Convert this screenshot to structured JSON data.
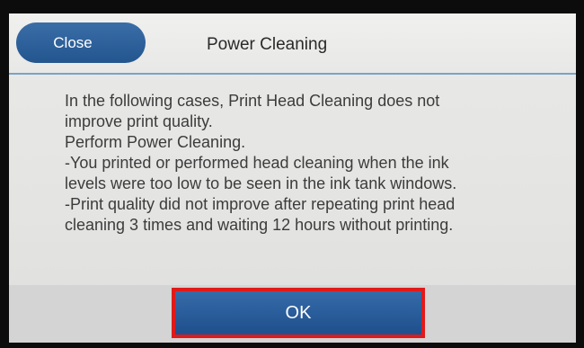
{
  "header": {
    "close_label": "Close",
    "title": "Power Cleaning"
  },
  "message": {
    "lines": [
      "In the following cases, Print Head Cleaning does not",
      "improve print quality.",
      "Perform Power Cleaning.",
      "-You printed or performed head cleaning when the ink",
      "levels were too low to be seen in the ink tank windows.",
      "-Print quality did not improve after repeating print head",
      "cleaning 3 times and waiting 12 hours without printing."
    ]
  },
  "footer": {
    "ok_label": "OK"
  },
  "colors": {
    "button_blue": "#23558f",
    "highlight_red": "#e01a1a"
  }
}
